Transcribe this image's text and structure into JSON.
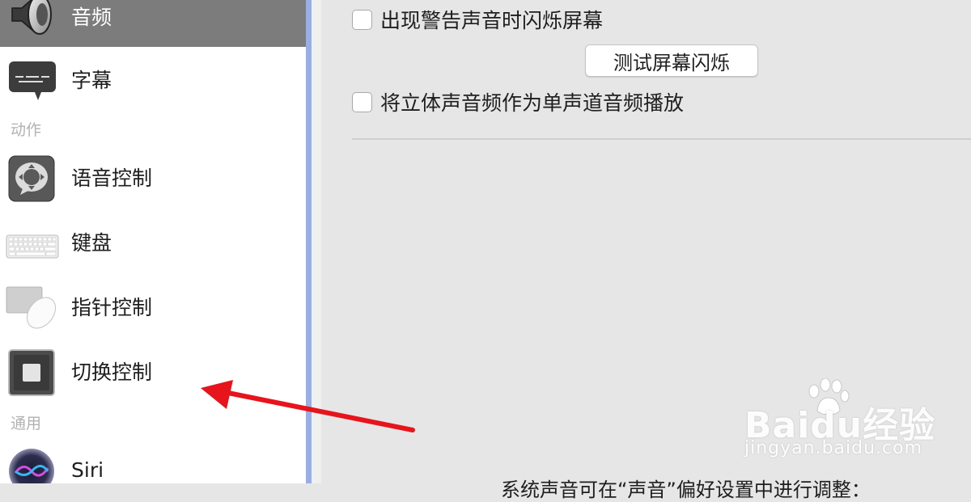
{
  "sidebar": {
    "items": [
      {
        "label": "音频",
        "icon": "speaker-icon"
      },
      {
        "label": "字幕",
        "icon": "captions-icon"
      },
      {
        "label": "语音控制",
        "icon": "voice-control-icon"
      },
      {
        "label": "键盘",
        "icon": "keyboard-icon"
      },
      {
        "label": "指针控制",
        "icon": "pointer-control-icon"
      },
      {
        "label": "切换控制",
        "icon": "switch-control-icon"
      },
      {
        "label": "Siri",
        "icon": "siri-icon"
      }
    ],
    "sections": {
      "motor": "动作",
      "general": "通用"
    },
    "selected": "音频"
  },
  "main": {
    "flash_screen_label": "出现警告声音时闪烁屏幕",
    "test_flash_button": "测试屏幕闪烁",
    "mono_audio_label": "将立体声音频作为单声道音频播放",
    "bottom_note": "系统声音可在“声音”偏好设置中进行调整："
  },
  "watermark": {
    "brand": "Baidu经验",
    "url": "jingyan.baidu.com"
  },
  "colors": {
    "selected_row": "#7c7c7c",
    "sidebar_divider": "#98aee6",
    "arrow": "#e8141c"
  }
}
